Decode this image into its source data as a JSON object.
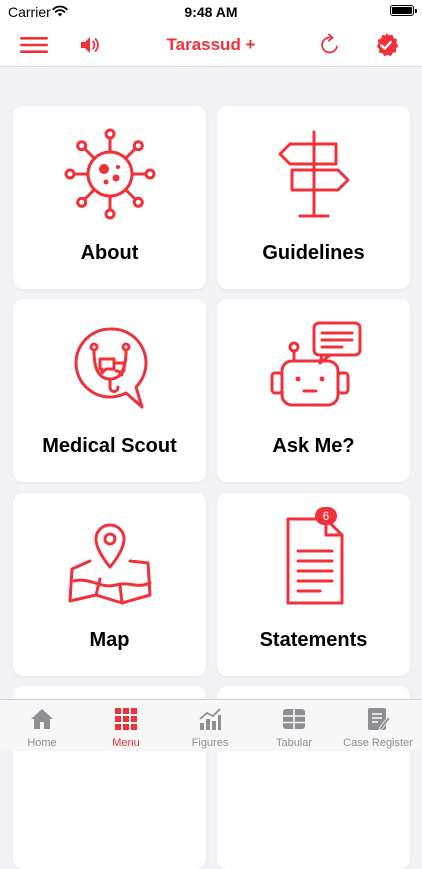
{
  "status_bar": {
    "carrier": "Carrier",
    "time": "9:48 AM"
  },
  "navbar": {
    "title": "Tarassud +"
  },
  "menu": [
    {
      "label": "About",
      "icon": "virus-icon"
    },
    {
      "label": "Guidelines",
      "icon": "signpost-icon"
    },
    {
      "label": "Medical Scout",
      "icon": "stethoscope-chat-icon"
    },
    {
      "label": "Ask Me?",
      "icon": "robot-chat-icon"
    },
    {
      "label": "Map",
      "icon": "map-pin-icon"
    },
    {
      "label": "Statements",
      "icon": "document-icon",
      "badge": "6"
    }
  ],
  "tabs": [
    {
      "label": "Home",
      "icon": "home-icon",
      "active": false
    },
    {
      "label": "Menu",
      "icon": "grid-icon",
      "active": true
    },
    {
      "label": "Figures",
      "icon": "bar-chart-icon",
      "active": false
    },
    {
      "label": "Tabular",
      "icon": "table-icon",
      "active": false
    },
    {
      "label": "Case Register",
      "icon": "clipboard-icon",
      "active": false
    }
  ],
  "colors": {
    "accent": "#f0313a",
    "inactive": "#8e8e93",
    "background": "#f2f2f7"
  }
}
